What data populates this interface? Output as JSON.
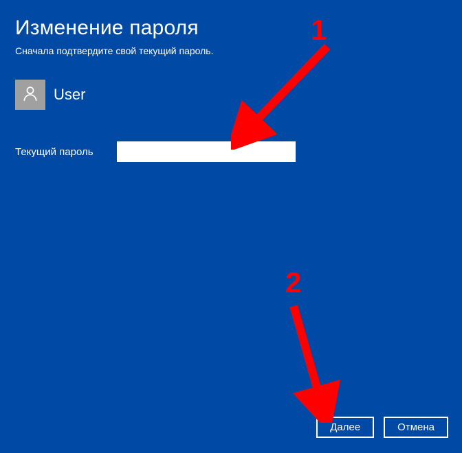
{
  "title": "Изменение пароля",
  "subtitle": "Сначала подтвердите свой текущий пароль.",
  "user": {
    "name": "User"
  },
  "field": {
    "label": "Текущий пароль",
    "value": ""
  },
  "buttons": {
    "next": "Далее",
    "cancel": "Отмена"
  },
  "annotations": {
    "one": "1",
    "two": "2"
  }
}
